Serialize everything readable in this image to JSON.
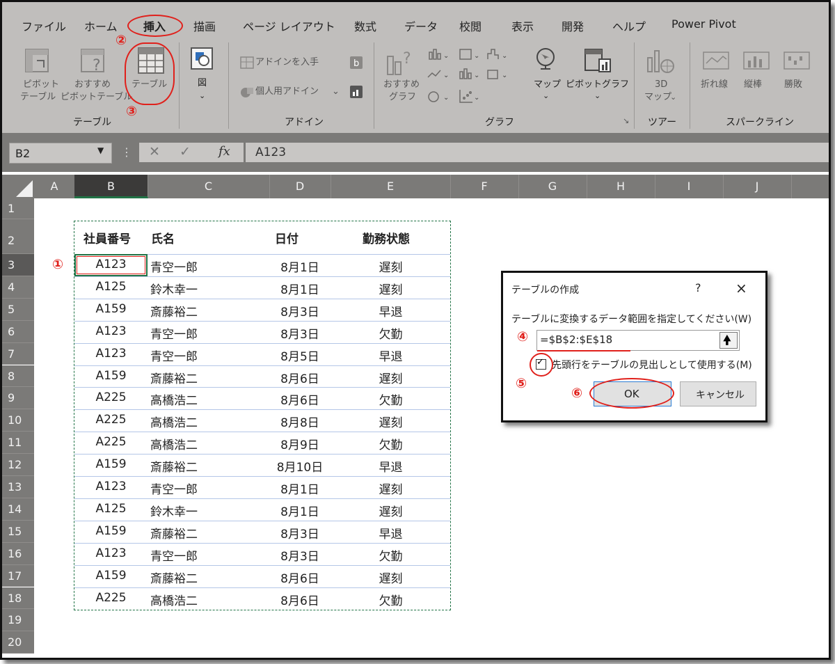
{
  "ribbon": {
    "tabs": [
      "ファイル",
      "ホーム",
      "挿入",
      "描画",
      "ページ レイアウト",
      "数式",
      "データ",
      "校閲",
      "表示",
      "開発",
      "ヘルプ",
      "Power Pivot"
    ],
    "pivot_table_label_1": "ピボット",
    "pivot_table_label_2": "テーブル",
    "recommended_pivot_label_1": "おすすめ",
    "recommended_pivot_label_2": "ピボットテーブル",
    "table_label": "テーブル",
    "tables_group": "テーブル",
    "illustrations_label": "図",
    "get_addins": "アドインを入手",
    "my_addins": "個人用アドイン",
    "addins_group": "アドイン",
    "recommended_charts_1": "おすすめ",
    "recommended_charts_2": "グラフ",
    "maps_label": "マップ",
    "pivot_chart_label": "ピボットグラフ",
    "charts_group": "グラフ",
    "map3d_1": "3D",
    "map3d_2": "マップ",
    "tours_group": "ツアー",
    "spark_line": "折れ線",
    "spark_column": "縦棒",
    "spark_winloss": "勝敗",
    "sparklines_group": "スパークライン"
  },
  "formula_bar": {
    "name_box": "B2",
    "fx": "fx",
    "value": "A123"
  },
  "columns": [
    "A",
    "B",
    "C",
    "D",
    "E",
    "F",
    "G",
    "H",
    "I",
    "J"
  ],
  "rows": [
    "1",
    "2",
    "3",
    "4",
    "5",
    "6",
    "7",
    "8",
    "9",
    "10",
    "11",
    "12",
    "13",
    "14",
    "15",
    "16",
    "17",
    "18",
    "19",
    "20"
  ],
  "table": {
    "headers": [
      "社員番号",
      "氏名",
      "日付",
      "勤務状態"
    ],
    "rows": [
      [
        "A123",
        "青空一郎",
        "8月1日",
        "遅刻"
      ],
      [
        "A125",
        "鈴木幸一",
        "8月1日",
        "遅刻"
      ],
      [
        "A159",
        "斎藤裕二",
        "8月3日",
        "早退"
      ],
      [
        "A123",
        "青空一郎",
        "8月3日",
        "欠勤"
      ],
      [
        "A123",
        "青空一郎",
        "8月5日",
        "早退"
      ],
      [
        "A159",
        "斎藤裕二",
        "8月6日",
        "遅刻"
      ],
      [
        "A225",
        "高橋浩二",
        "8月6日",
        "欠勤"
      ],
      [
        "A225",
        "高橋浩二",
        "8月8日",
        "遅刻"
      ],
      [
        "A225",
        "高橋浩二",
        "8月9日",
        "欠勤"
      ],
      [
        "A159",
        "斎藤裕二",
        "8月10日",
        "早退"
      ],
      [
        "A123",
        "青空一郎",
        "8月1日",
        "遅刻"
      ],
      [
        "A125",
        "鈴木幸一",
        "8月1日",
        "遅刻"
      ],
      [
        "A159",
        "斎藤裕二",
        "8月3日",
        "早退"
      ],
      [
        "A123",
        "青空一郎",
        "8月3日",
        "欠勤"
      ],
      [
        "A159",
        "斎藤裕二",
        "8月6日",
        "遅刻"
      ],
      [
        "A225",
        "高橋浩二",
        "8月6日",
        "欠勤"
      ]
    ]
  },
  "dialog": {
    "title": "テーブルの作成",
    "help": "?",
    "close": "×",
    "prompt": "テーブルに変換するデータ範囲を指定してください(W)",
    "range_value": "=$B$2:$E$18",
    "checkbox_label": "先頭行をテーブルの見出しとして使用する(M)",
    "checkbox_checked": true,
    "ok_label": "OK",
    "cancel_label": "キャンセル"
  },
  "annotations": [
    "①",
    "②",
    "③",
    "④",
    "⑤",
    "⑥"
  ],
  "colors": {
    "accent_red": "#e0201b",
    "ribbon_bg": "#c0bebc",
    "header_bg": "#7b7a78",
    "table_border": "#217346"
  }
}
